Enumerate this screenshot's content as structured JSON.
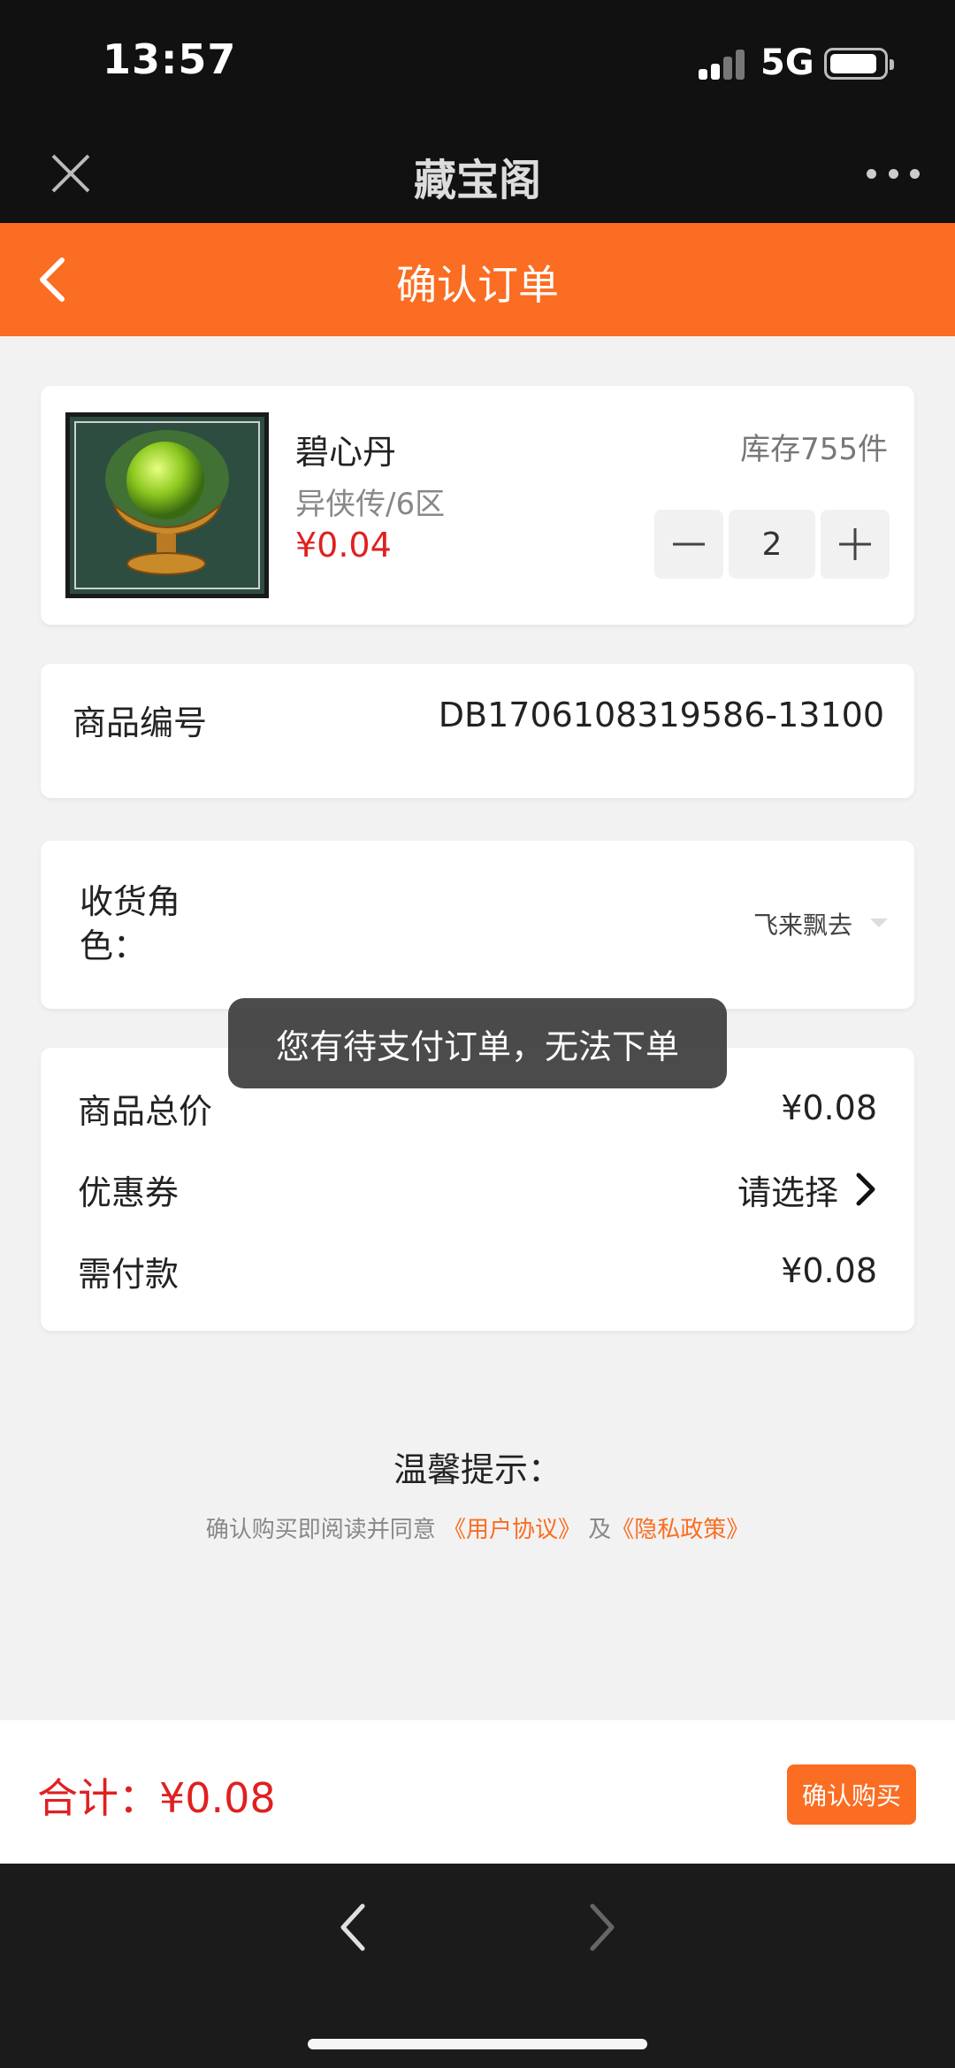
{
  "status_bar": {
    "time": "13:57",
    "network": "5G"
  },
  "app_header": {
    "title": "藏宝阁"
  },
  "order_header": {
    "title": "确认订单"
  },
  "product": {
    "name": "碧心丹",
    "server": "异侠传/6区",
    "price": "¥0.04",
    "stock": "库存755件",
    "quantity": "2"
  },
  "sku": {
    "label": "商品编号",
    "value": "DB1706108319586-13100"
  },
  "role": {
    "label": "收货角色：",
    "value": "飞来飘去"
  },
  "toast": "您有待支付订单，无法下单",
  "summary": {
    "total_label": "商品总价",
    "total_value": "¥0.08",
    "coupon_label": "优惠券",
    "coupon_value": "请选择",
    "pay_label": "需付款",
    "pay_value": "¥0.08"
  },
  "tips": {
    "title": "温馨提示：",
    "prefix": "确认购买即阅读并同意",
    "user_agreement": "《用户协议》",
    "and": "及",
    "privacy_policy": "《隐私政策》"
  },
  "bottom": {
    "total": "合计：¥0.08",
    "buy_label": "确认购买"
  },
  "colors": {
    "accent": "#fa6d22",
    "price": "#e02020",
    "toast_bg": "#3c3c3c"
  },
  "icons": [
    "close-icon",
    "more-icon",
    "back-icon",
    "minus-icon",
    "plus-icon",
    "chevron-right-icon",
    "dropdown-caret-icon",
    "nav-back-icon",
    "nav-forward-icon"
  ]
}
